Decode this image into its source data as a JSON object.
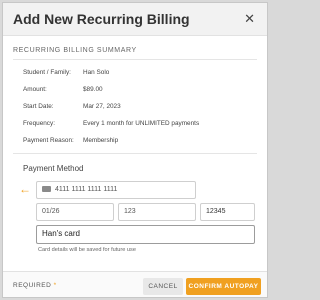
{
  "modal": {
    "title": "Add New Recurring Billing",
    "close_icon": "close-icon"
  },
  "summary": {
    "section_title": "RECURRING BILLING SUMMARY",
    "rows": [
      {
        "label": "Student / Family:",
        "value": "Han Solo"
      },
      {
        "label": "Amount:",
        "value": "$89.00"
      },
      {
        "label": "Start Date:",
        "value": "Mar 27, 2023"
      },
      {
        "label": "Frequency:",
        "value": "Every 1 month for UNLIMITED payments"
      },
      {
        "label": "Payment Reason:",
        "value": "Membership"
      }
    ]
  },
  "payment": {
    "title": "Payment Method",
    "card_number_placeholder": "4111 1111 1111 1111",
    "expiry_placeholder": "01/26",
    "cvc_placeholder": "123",
    "zip_value": "12345",
    "name_value": "Han's card",
    "note": "Card details will be saved for future use",
    "arrow_icon": "arrow-left-icon",
    "card_icon": "credit-card-icon",
    "accent_color": "#f0a020"
  },
  "footer": {
    "required_label": "REQUIRED",
    "required_star": "*",
    "cancel_label": "CANCEL",
    "confirm_label": "CONFIRM AUTOPAY"
  }
}
